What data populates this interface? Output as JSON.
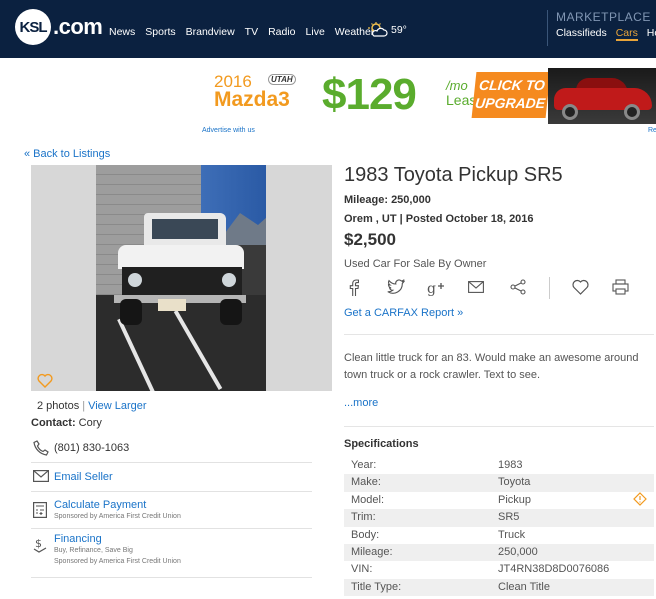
{
  "header": {
    "logo_mark": "KSL",
    "logo_text": ".com",
    "nav": [
      "News",
      "Sports",
      "Brandview",
      "TV",
      "Radio",
      "Live",
      "Weather"
    ],
    "weather_temp": "59°",
    "marketplace_title": "MARKETPLACE",
    "marketplace_links": [
      "Classifieds",
      "Cars",
      "Hom"
    ]
  },
  "ad": {
    "year": "2016",
    "badge": "UTAH",
    "model": "Mazda3",
    "price": "$129",
    "per": "/mo",
    "term": "Lease",
    "cta_line1": "CLICK TO",
    "cta_line2": "UPGRADE",
    "advertise_link": "Advertise with us",
    "right_link": "Re"
  },
  "back_link": "« Back to Listings",
  "photos": {
    "count_text": "2 photos",
    "view_larger": "View Larger"
  },
  "contact": {
    "label": "Contact:",
    "name": "Cory",
    "phone": "(801) 830-1063",
    "email": "Email Seller",
    "calc_label": "Calculate Payment",
    "calc_sub": "Sponsored by America First Credit Union",
    "fin_label": "Financing",
    "fin_sub1": "Buy, Refinance, Save Big",
    "fin_sub2": "Sponsored by America First Credit Union"
  },
  "listing": {
    "title": "1983 Toyota Pickup SR5",
    "mileage": "Mileage: 250,000",
    "location": "Orem , UT | Posted October 18, 2016",
    "price": "$2,500",
    "sale_type": "Used Car For Sale By Owner",
    "carfax": "Get a CARFAX Report »",
    "description": "Clean little truck for an 83. Would make an awesome around town truck or a rock crawler. Text to see.",
    "more": "...more"
  },
  "specs": {
    "heading": "Specifications",
    "rows": [
      {
        "k": "Year:",
        "v": "1983"
      },
      {
        "k": "Make:",
        "v": "Toyota"
      },
      {
        "k": "Model:",
        "v": "Pickup"
      },
      {
        "k": "Trim:",
        "v": "SR5"
      },
      {
        "k": "Body:",
        "v": "Truck"
      },
      {
        "k": "Mileage:",
        "v": "250,000"
      },
      {
        "k": "VIN:",
        "v": "JT4RN38D8D0076086"
      },
      {
        "k": "Title Type:",
        "v": "Clean Title"
      }
    ]
  },
  "colors": {
    "nav_bg": "#0b2140",
    "link": "#1a73c8",
    "accent_orange": "#f29a1f",
    "ad_green": "#5aac2d"
  }
}
